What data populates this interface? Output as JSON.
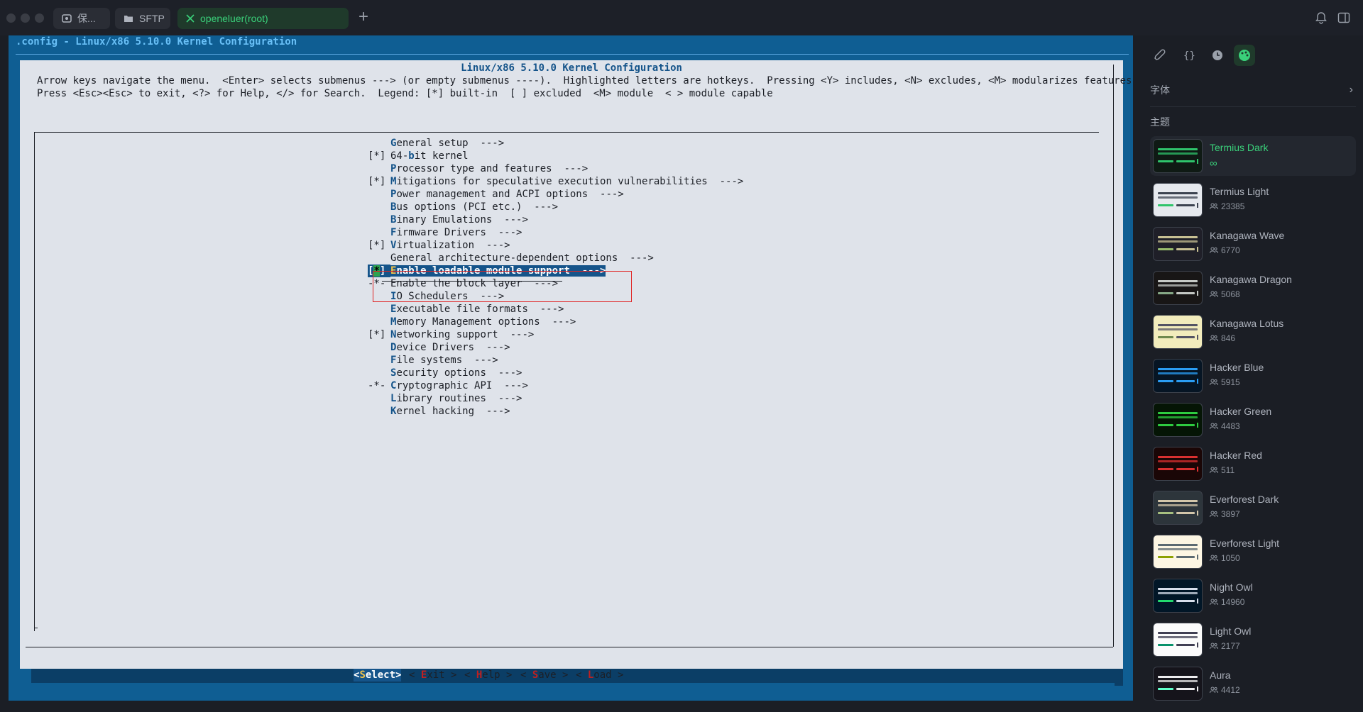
{
  "tabs": [
    {
      "label": "保...",
      "icon": "vault-icon"
    },
    {
      "label": "SFTP",
      "icon": "folder-icon"
    },
    {
      "label": "openeluer(root)",
      "icon": "terminal-close-icon"
    }
  ],
  "new_tab_label": "+",
  "terminal": {
    "window_title": ".config - Linux/x86 5.10.0 Kernel Configuration",
    "dialog_title": "Linux/x86 5.10.0 Kernel Configuration",
    "help_line1": "Arrow keys navigate the menu.  <Enter> selects submenus ---> (or empty submenus ----).  Highlighted letters are hotkeys.  Pressing <Y> includes, <N> excludes, <M> modularizes features.",
    "help_line2": "Press <Esc><Esc> to exit, <?> for Help, </> for Search.  Legend: [*] built-in  [ ] excluded  <M> module  < > module capable",
    "menu": [
      {
        "prefix": "",
        "hot": "G",
        "rest": "eneral setup  --->"
      },
      {
        "prefix": "[*]",
        "hot": "",
        "rest": "64-",
        "hot2": "b",
        "rest2": "it kernel"
      },
      {
        "prefix": "",
        "hot": "P",
        "rest": "rocessor type and features  --->"
      },
      {
        "prefix": "[*]",
        "hot": "M",
        "rest": "itigations for speculative execution vulnerabilities  --->"
      },
      {
        "prefix": "",
        "hot": "P",
        "rest": "ower management and ACPI options  --->"
      },
      {
        "prefix": "",
        "hot": "B",
        "rest": "us options (PCI etc.)  --->"
      },
      {
        "prefix": "",
        "hot": "B",
        "rest": "inary Emulations  --->"
      },
      {
        "prefix": "",
        "hot": "F",
        "rest": "irmware Drivers  --->"
      },
      {
        "prefix": "[*]",
        "hot": "V",
        "rest": "irtualization  --->"
      },
      {
        "prefix": "",
        "hot": "",
        "rest": "General architecture-dependent options  --->"
      },
      {
        "prefix": "[*]",
        "hot": "E",
        "rest": "nable loadable module support  --->",
        "selected": true
      },
      {
        "prefix": "-*-",
        "hot": "",
        "rest": "Enable the block layer  --->"
      },
      {
        "prefix": "",
        "hot": "I",
        "rest": "O Schedulers  --->"
      },
      {
        "prefix": "",
        "hot": "E",
        "rest": "xecutable file formats  --->"
      },
      {
        "prefix": "",
        "hot": "M",
        "rest": "emory Management options  --->"
      },
      {
        "prefix": "[*]",
        "hot": "N",
        "rest": "etworking support  --->"
      },
      {
        "prefix": "",
        "hot": "D",
        "rest": "evice Drivers  --->"
      },
      {
        "prefix": "",
        "hot": "F",
        "rest": "ile systems  --->"
      },
      {
        "prefix": "",
        "hot": "S",
        "rest": "ecurity options  --->"
      },
      {
        "prefix": "-*-",
        "hot": "C",
        "rest": "ryptographic API  --->"
      },
      {
        "prefix": "",
        "hot": "L",
        "rest": "ibrary routines  --->"
      },
      {
        "prefix": "",
        "hot": "K",
        "rest": "ernel hacking  --->"
      }
    ],
    "buttons": [
      {
        "pre": "<",
        "hot": "S",
        "rest": "elect>",
        "selected": true
      },
      {
        "pre": "< ",
        "hot": "E",
        "rest": "xit >"
      },
      {
        "pre": "< ",
        "hot": "H",
        "rest": "elp >"
      },
      {
        "pre": "< ",
        "hot": "S",
        "rest": "ave >"
      },
      {
        "pre": "< ",
        "hot": "L",
        "rest": "oad >"
      }
    ]
  },
  "panel": {
    "font_section": "字体",
    "theme_section": "主题",
    "themes": [
      {
        "name": "Termius Dark",
        "count": "∞",
        "bg": "#0f1a14",
        "line": "#2fc46b",
        "accent": "#2fc46b",
        "active": true
      },
      {
        "name": "Termius Light",
        "count": "23385",
        "bg": "#e6e9ee",
        "line": "#3c4350",
        "accent": "#2fc46b"
      },
      {
        "name": "Kanagawa Wave",
        "count": "6770",
        "bg": "#1f1f28",
        "line": "#c8c093",
        "accent": "#98bb6c"
      },
      {
        "name": "Kanagawa Dragon",
        "count": "5068",
        "bg": "#181616",
        "line": "#c5c9c5",
        "accent": "#87a987"
      },
      {
        "name": "Kanagawa Lotus",
        "count": "846",
        "bg": "#f2ecbc",
        "line": "#545464",
        "accent": "#6f894e"
      },
      {
        "name": "Hacker Blue",
        "count": "5915",
        "bg": "#061524",
        "line": "#2a9df4",
        "accent": "#2a9df4"
      },
      {
        "name": "Hacker Green",
        "count": "4483",
        "bg": "#051505",
        "line": "#2ecc40",
        "accent": "#2ecc40"
      },
      {
        "name": "Hacker Red",
        "count": "511",
        "bg": "#1a0606",
        "line": "#d93030",
        "accent": "#d93030"
      },
      {
        "name": "Everforest Dark",
        "count": "3897",
        "bg": "#2d353b",
        "line": "#d3c6aa",
        "accent": "#a7c080"
      },
      {
        "name": "Everforest Light",
        "count": "1050",
        "bg": "#fdf6e3",
        "line": "#5c6a72",
        "accent": "#8da101"
      },
      {
        "name": "Night Owl",
        "count": "14960",
        "bg": "#011627",
        "line": "#d6deeb",
        "accent": "#22da6e"
      },
      {
        "name": "Light Owl",
        "count": "2177",
        "bg": "#fbfbfb",
        "line": "#403f53",
        "accent": "#08916a"
      },
      {
        "name": "Aura",
        "count": "4412",
        "bg": "#15141b",
        "line": "#edecee",
        "accent": "#61ffca"
      }
    ]
  }
}
